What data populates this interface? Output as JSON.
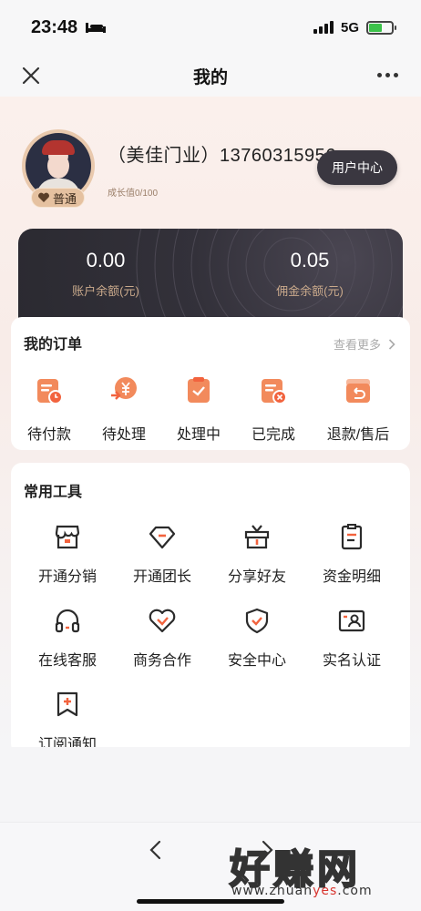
{
  "status_bar": {
    "time": "23:48",
    "network": "5G"
  },
  "nav": {
    "title": "我的"
  },
  "profile": {
    "shop_name": "（美佳门业）13760315956",
    "level": "普通",
    "growth": "成长值0/100",
    "user_center_label": "用户中心"
  },
  "balances": [
    {
      "value": "0.00",
      "label": "账户余额(元)"
    },
    {
      "value": "0.05",
      "label": "佣金余额(元)"
    }
  ],
  "orders": {
    "title": "我的订单",
    "see_more": "查看更多",
    "items": [
      {
        "label": "待付款",
        "icon": "pending-payment-icon"
      },
      {
        "label": "待处理",
        "icon": "pending-process-icon"
      },
      {
        "label": "处理中",
        "icon": "processing-icon"
      },
      {
        "label": "已完成",
        "icon": "completed-icon"
      },
      {
        "label": "退款/售后",
        "icon": "refund-icon"
      }
    ]
  },
  "tools": {
    "title": "常用工具",
    "items": [
      {
        "label": "开通分销",
        "icon": "store-icon"
      },
      {
        "label": "开通团长",
        "icon": "diamond-icon"
      },
      {
        "label": "分享好友",
        "icon": "gift-icon"
      },
      {
        "label": "资金明细",
        "icon": "clipboard-icon"
      },
      {
        "label": "在线客服",
        "icon": "headset-icon"
      },
      {
        "label": "商务合作",
        "icon": "handshake-icon"
      },
      {
        "label": "安全中心",
        "icon": "shield-icon"
      },
      {
        "label": "实名认证",
        "icon": "id-card-icon"
      },
      {
        "label": "订阅通知",
        "icon": "bookmark-icon"
      }
    ]
  },
  "watermark": {
    "text": "好赚网",
    "url_prefix": "www.zhuan",
    "url_highlight": "yes",
    "url_suffix": ".com"
  },
  "colors": {
    "accent": "#f2633e",
    "dark_card": "#2f2d35",
    "gold": "#c9a98b"
  }
}
